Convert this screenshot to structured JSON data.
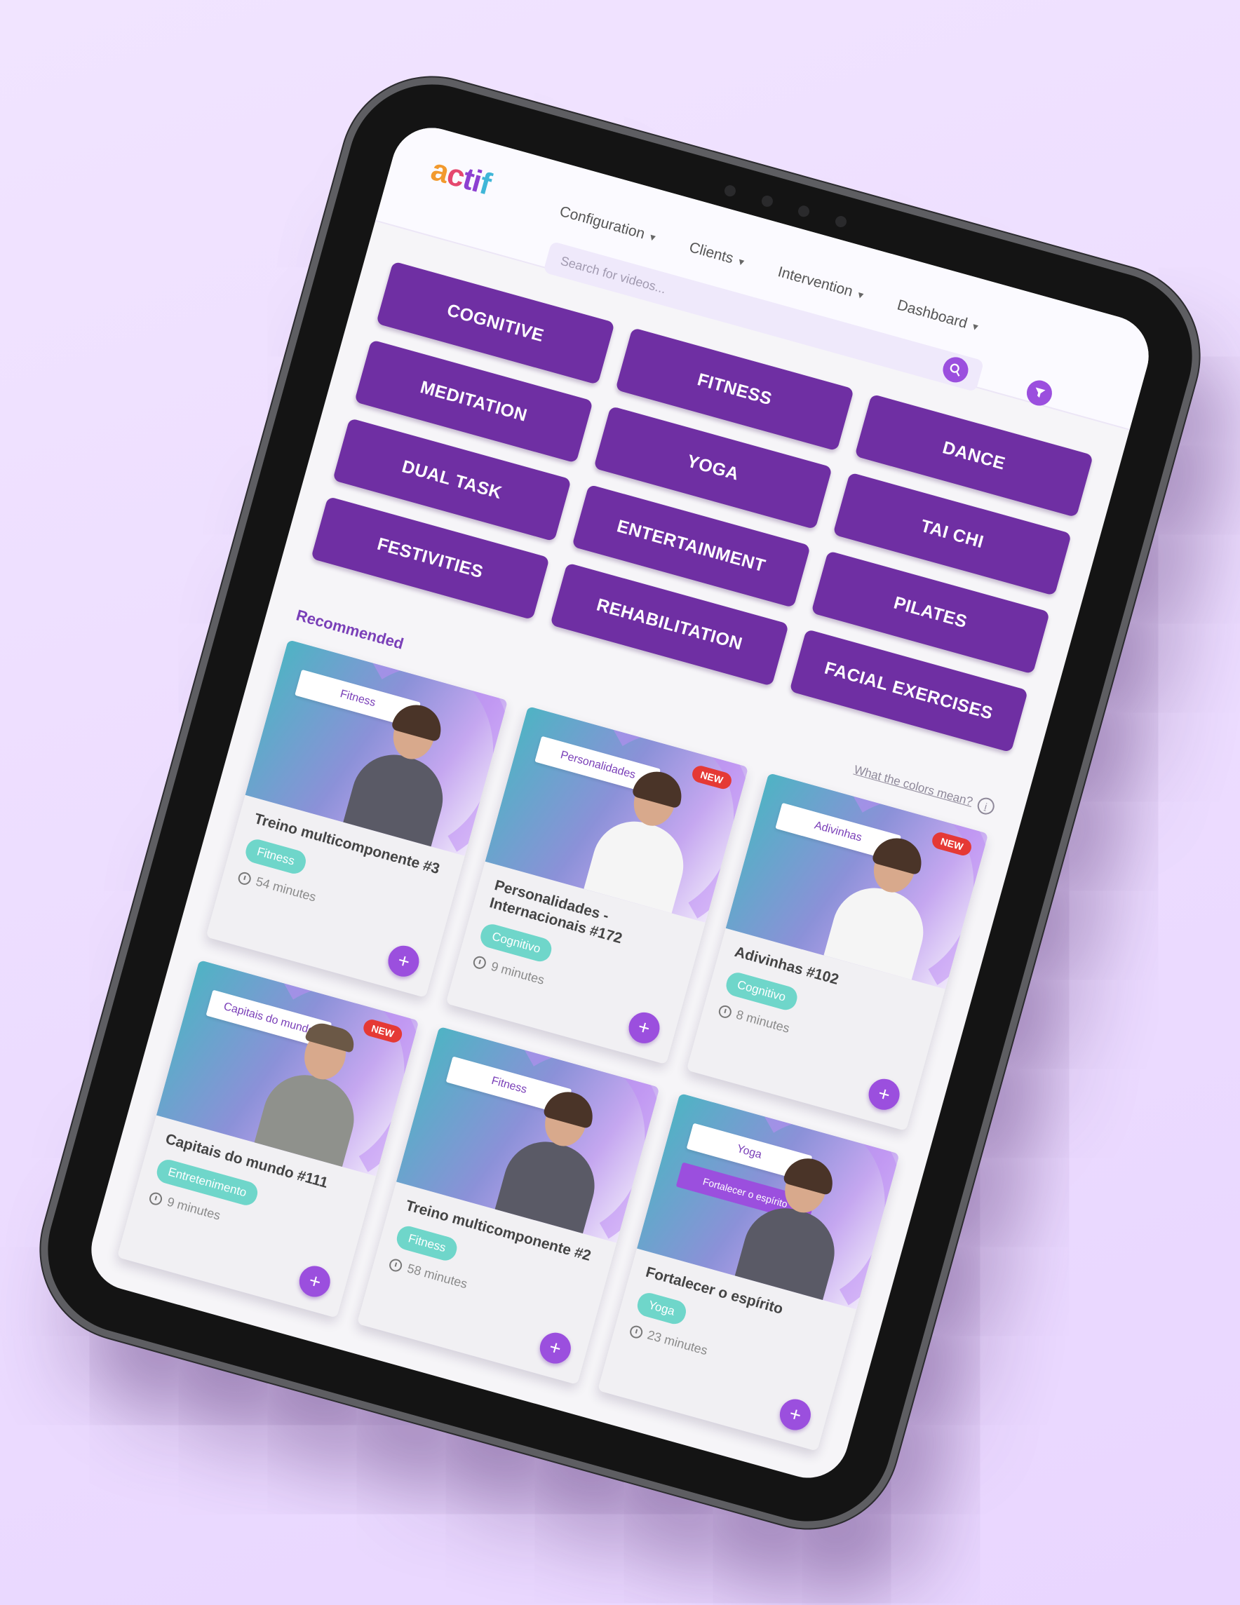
{
  "app": {
    "logo": {
      "a": "a",
      "c": "c",
      "ti": "ti",
      "f": "f"
    }
  },
  "nav": {
    "configuration": "Configuration",
    "clients": "Clients",
    "intervention": "Intervention",
    "dashboard": "Dashboard"
  },
  "search": {
    "placeholder": "Search for videos..."
  },
  "icons": {
    "search": "search-icon",
    "filter": "filter-icon",
    "add": "plus-icon",
    "clock": "clock-icon",
    "info": "info-icon"
  },
  "colors": {
    "accent": "#6f2fa3",
    "button": "#9b4fde",
    "tag": "#6fd6ca",
    "badge": "#e53935"
  },
  "categories": [
    "COGNITIVE",
    "FITNESS",
    "DANCE",
    "MEDITATION",
    "YOGA",
    "TAI CHI",
    "DUAL TASK",
    "ENTERTAINMENT",
    "PILATES",
    "FESTIVITIES",
    "REHABILITATION",
    "FACIAL EXERCISES"
  ],
  "recommended": {
    "title": "Recommended",
    "colors_link": "What the colors mean?",
    "info_symbol": "i",
    "new_badge": "NEW",
    "add_symbol": "+",
    "cards": [
      {
        "thumb_label": "Fitness",
        "title": "Treino multicomponente #3",
        "tag": "Fitness",
        "duration": "54 minutes"
      },
      {
        "thumb_label": "Personalidades",
        "title": "Personalidades - Internacionais #172",
        "tag": "Cognitivo",
        "duration": "9 minutes"
      },
      {
        "thumb_label": "Adivinhas",
        "title": "Adivinhas #102",
        "tag": "Cognitivo",
        "duration": "8 minutes"
      },
      {
        "thumb_label": "Capitais do mundo",
        "title": "Capitais do mundo #111",
        "tag": "Entretenimento",
        "duration": "9 minutes"
      },
      {
        "thumb_label": "Fitness",
        "title": "Treino multicomponente #2",
        "tag": "Fitness",
        "duration": "58 minutes"
      },
      {
        "thumb_label": "Yoga",
        "thumb_label2": "Fortalecer o espírito",
        "title": "Fortalecer o espírito",
        "tag": "Yoga",
        "duration": "23 minutes"
      }
    ]
  }
}
